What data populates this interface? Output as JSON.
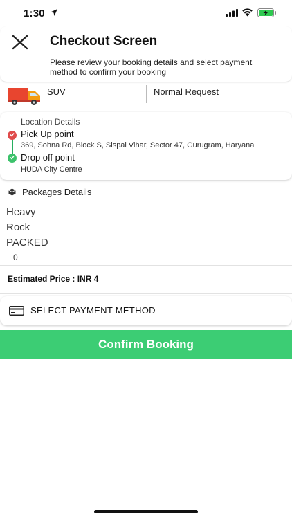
{
  "status_bar": {
    "time": "1:30",
    "battery_color": "#2fc950"
  },
  "header": {
    "title": "Checkout Screen",
    "subtitle": "Please review your booking details and select payment method to confirm your booking",
    "close_icon": "close-icon"
  },
  "vehicle": {
    "type": "SUV",
    "request": "Normal Request",
    "icon": "truck-icon"
  },
  "location": {
    "title": "Location Details",
    "pickup_label": "Pick Up point",
    "pickup_address": "369, Sohna Rd, Block S, Sispal Vihar, Sector 47, Gurugram, Haryana",
    "drop_label": "Drop off point",
    "drop_address": "HUDA City Centre",
    "pickup_color": "#e04b4b",
    "drop_color": "#3cc26b"
  },
  "packages": {
    "title": "Packages Details",
    "weight": "Heavy",
    "material": "Rock",
    "packing": "PACKED",
    "quantity": "0"
  },
  "price": {
    "text": "Estimated Price : INR 4"
  },
  "payment": {
    "label": "SELECT PAYMENT METHOD",
    "icon": "credit-card-icon"
  },
  "confirm": {
    "label": "Confirm Booking",
    "color": "#3ccd74"
  }
}
